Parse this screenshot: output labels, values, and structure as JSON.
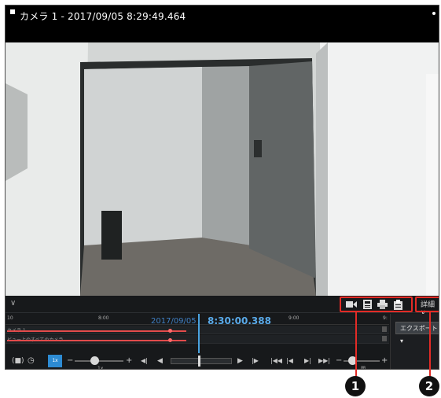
{
  "camera": {
    "title": "カメラ 1 - 2017/09/05 8:29:49.464"
  },
  "timeline": {
    "ticks": [
      "10",
      "8:00",
      "9:00",
      "9:"
    ],
    "date": "2017/09/05",
    "time": "8:30:00.388",
    "tracks": [
      {
        "label": "カメラ 1"
      },
      {
        "label": "ビュー上のすべてのカメラ"
      }
    ]
  },
  "toolbar": {
    "detail_label": "詳細",
    "detail_chevron": "∨",
    "collapse_chevron": "∨",
    "tools": [
      "video-export-icon",
      "save-icon",
      "print-icon",
      "clipboard-icon"
    ]
  },
  "side": {
    "export_label": "エクスポート",
    "export_caret": "▾"
  },
  "playback": {
    "speed_label": "1x",
    "active_label": "1x",
    "minus": "−",
    "plus": "+",
    "step_label": "間"
  },
  "callouts": [
    "1",
    "2"
  ],
  "colors": {
    "highlight": "#e32b26",
    "accent": "#2d8bd3",
    "track": "#e24b4b"
  }
}
